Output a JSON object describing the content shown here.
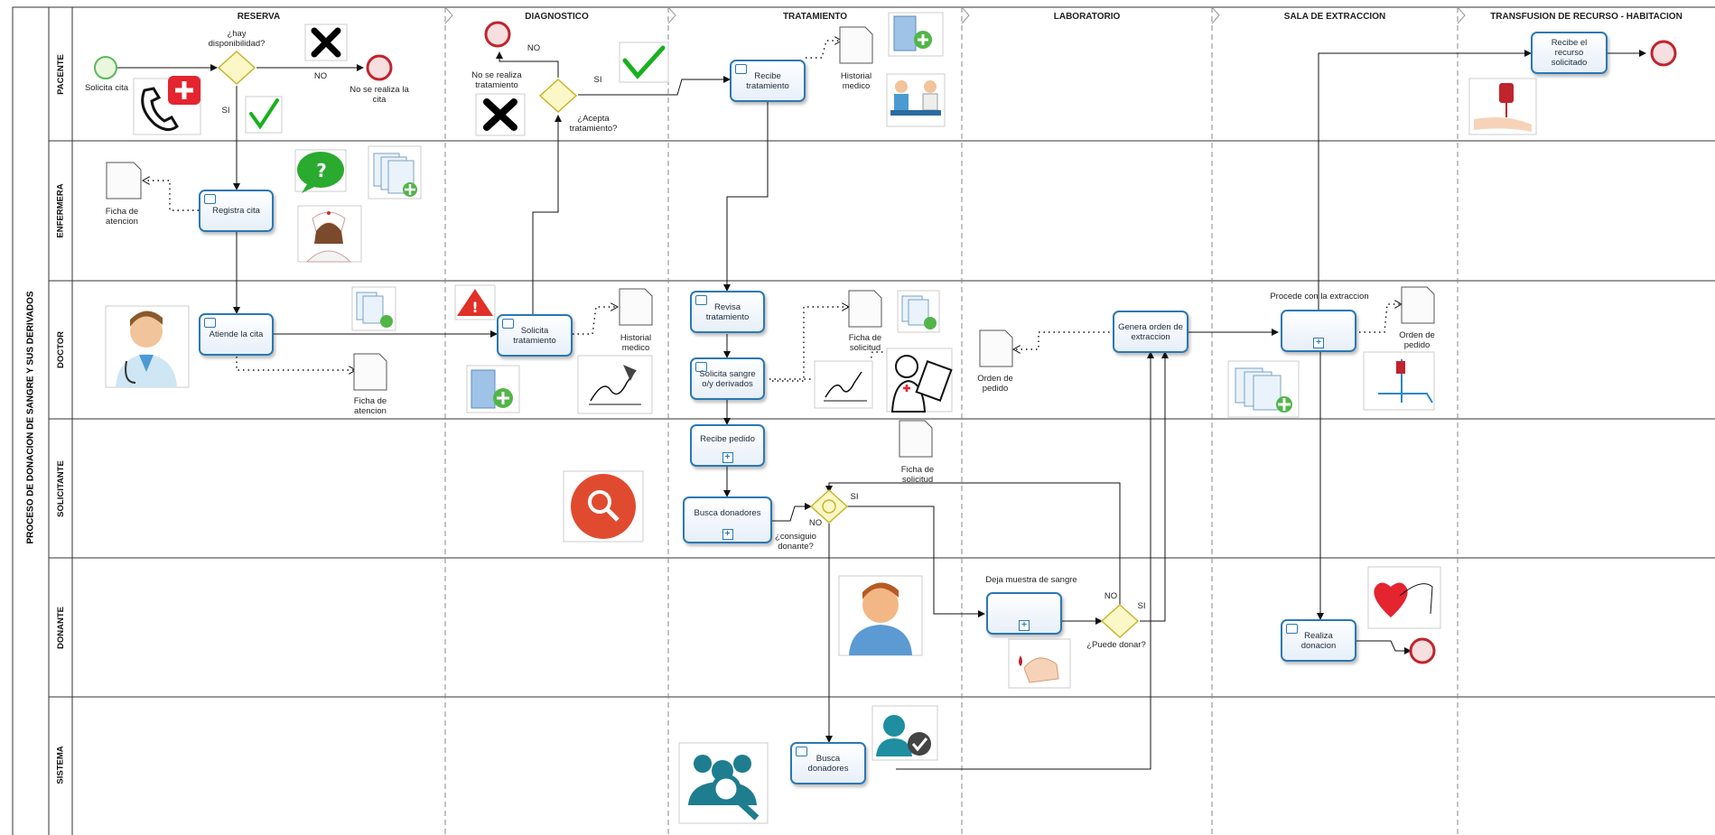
{
  "pool": {
    "title": "PROCESO DE DONACION DE SANGRE Y SUS DERIVADOS"
  },
  "lanes": [
    "PACENTE",
    "ENFERMERA",
    "DOCTOR",
    "SOLICITANTE",
    "DONANTE",
    "SISTEMA"
  ],
  "phases": [
    "RESERVA",
    "DIAGNOSTICO",
    "TRATAMIENTO",
    "LABORATORIO",
    "SALA DE EXTRACCION",
    "TRANSFUSION DE RECURSO - HABITACION"
  ],
  "tasks": {
    "registra_cita": "Registra cita",
    "atiende_cita": "Atiende la cita",
    "solicita_tratamiento": "Solicita tratamiento",
    "recibe_tratamiento": "Recibe tratamiento",
    "revisa_tratamiento": "Revisa tratamiento",
    "solicita_sangre": "Solicita sangre o/y derivados",
    "recibe_pedido": "Recibe pedido",
    "busca_donadores_sub": "Busca donadores",
    "busca_donadores_sys": "Busca donadores",
    "genera_orden": "Genera orden de extraccion",
    "procede_extraccion": "Procede con la extraccion",
    "deja_muestra": "Deja muestra de sangre",
    "realiza_donacion": "Realiza donacion",
    "recibe_recurso": "Recibe el recurso solicitado"
  },
  "events": {
    "solicita_cita": "Solicita cita",
    "no_cita": "No se realiza la cita",
    "no_tratamiento": "No se realiza tratamiento"
  },
  "gateways": {
    "disponibilidad": "¿hay disponibilidad?",
    "acepta": "¿Acepta tratamiento?",
    "consiguio": "¿consiguio donante?",
    "puede_donar": "¿Puede donar?"
  },
  "flow_labels": {
    "yes": "SI",
    "no": "NO"
  },
  "documents": {
    "ficha_atencion": "Ficha de atencion",
    "historial_medico": "Historial medico",
    "ficha_solicitud": "Ficha de solicitud",
    "orden_pedido": "Orden de pedido"
  },
  "colors": {
    "task_border": "#2a78b5",
    "start_event": "#5cb85c",
    "end_event": "#c0242c",
    "gateway": "#d9cf4b",
    "lane_line": "#333333",
    "phase_line": "#888888"
  }
}
